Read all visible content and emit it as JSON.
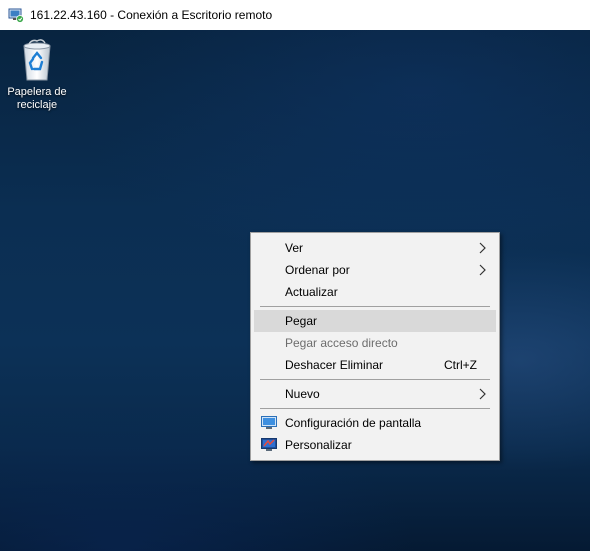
{
  "window": {
    "title": "161.22.43.160 - Conexión a Escritorio remoto"
  },
  "desktop": {
    "recycle_bin": {
      "label_line1": "Papelera de",
      "label_line2": "reciclaje"
    }
  },
  "context_menu": {
    "ver": "Ver",
    "ordenar_por": "Ordenar por",
    "actualizar": "Actualizar",
    "pegar": "Pegar",
    "pegar_acceso_directo": "Pegar acceso directo",
    "deshacer_eliminar": "Deshacer Eliminar",
    "deshacer_shortcut": "Ctrl+Z",
    "nuevo": "Nuevo",
    "configuracion_pantalla": "Configuración de pantalla",
    "personalizar": "Personalizar"
  },
  "colors": {
    "desktop_bg": "#0b2e52",
    "menu_bg": "#f2f2f2",
    "menu_hover": "#d9d9d9",
    "disabled_text": "#6d6d6d"
  }
}
